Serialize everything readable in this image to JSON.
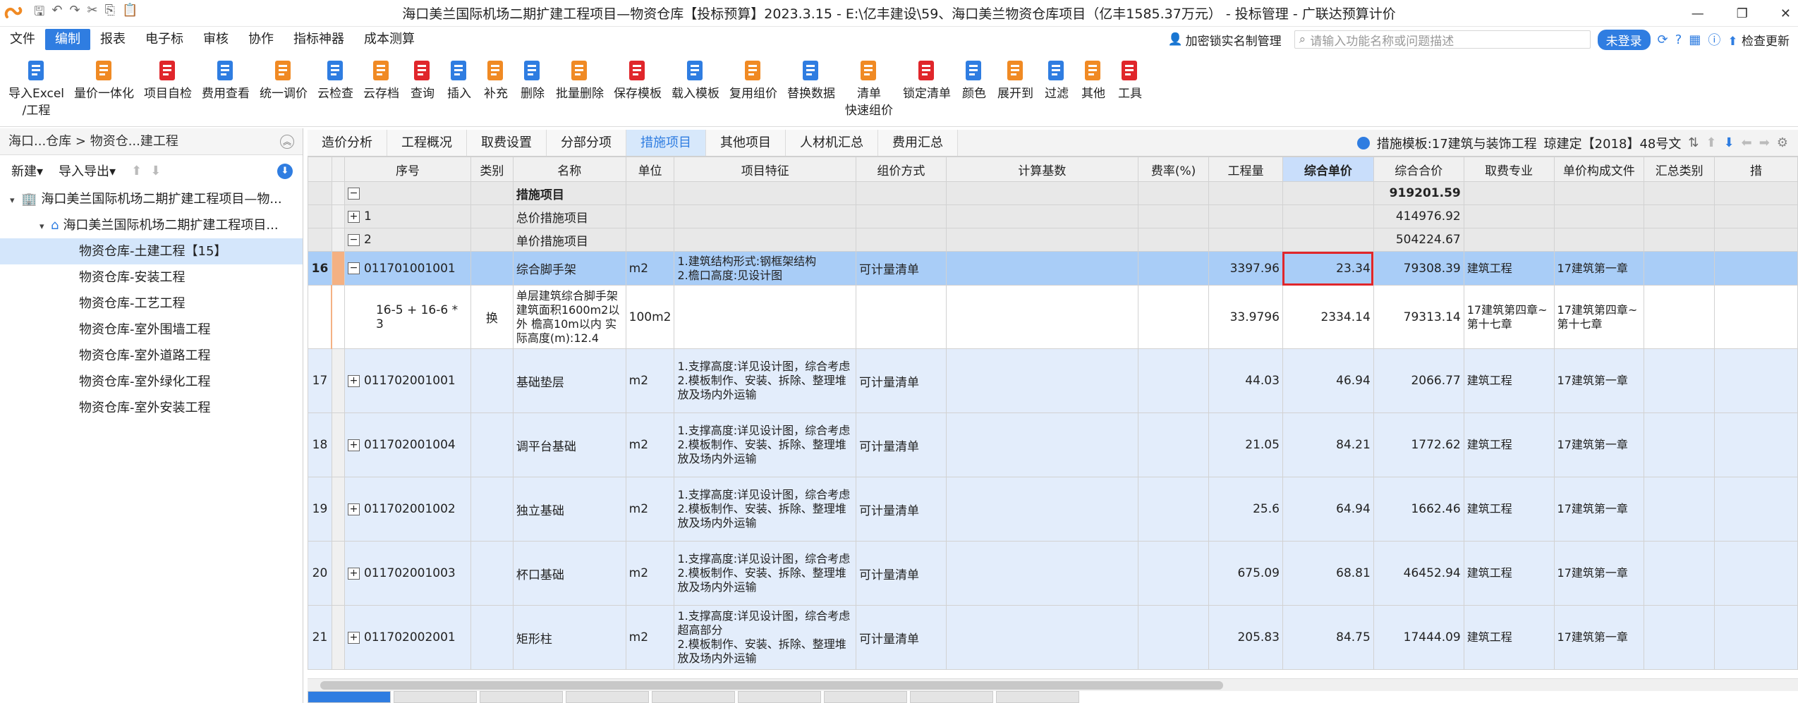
{
  "window": {
    "title": "海口美兰国际机场二期扩建工程项目—物资仓库【投标预算】2023.3.15  - E:\\亿丰建设\\59、海口美兰物资仓库项目（亿丰1585.37万元） - 投标管理 - 广联达预算计价"
  },
  "menu": {
    "items": [
      "文件",
      "编制",
      "报表",
      "电子标",
      "审核",
      "协作",
      "指标神器",
      "成本测算"
    ],
    "encrypt_label": "加密锁实名制管理",
    "search_placeholder": "请输入功能名称或问题描述",
    "login_label": "未登录",
    "update_label": "检查更新"
  },
  "ribbon": [
    {
      "label": "导入Excel",
      "label2": "/工程",
      "icon": "import-excel-icon"
    },
    {
      "label": "量价一体化",
      "icon": "quantity-price-icon"
    },
    {
      "label": "项目自检",
      "icon": "self-check-icon"
    },
    {
      "label": "费用查看",
      "icon": "cost-view-icon"
    },
    {
      "label": "统一调价",
      "icon": "unified-price-icon"
    },
    {
      "label": "云检查",
      "icon": "cloud-check-icon"
    },
    {
      "label": "云存档",
      "icon": "cloud-save-icon"
    },
    {
      "label": "查询",
      "icon": "query-icon"
    },
    {
      "label": "插入",
      "icon": "insert-icon"
    },
    {
      "label": "补充",
      "icon": "supplement-icon"
    },
    {
      "label": "删除",
      "icon": "delete-icon"
    },
    {
      "label": "批量删除",
      "icon": "batch-delete-icon"
    },
    {
      "label": "保存模板",
      "icon": "save-template-icon"
    },
    {
      "label": "载入模板",
      "icon": "load-template-icon"
    },
    {
      "label": "复用组价",
      "icon": "reuse-price-icon"
    },
    {
      "label": "替换数据",
      "icon": "replace-data-icon"
    },
    {
      "label": "清单",
      "label2": "快速组价",
      "icon": "quick-price-icon"
    },
    {
      "label": "锁定清单",
      "icon": "lock-list-icon"
    },
    {
      "label": "颜色",
      "icon": "color-icon"
    },
    {
      "label": "展开到",
      "icon": "expand-to-icon"
    },
    {
      "label": "过滤",
      "icon": "filter-icon"
    },
    {
      "label": "其他",
      "icon": "other-icon"
    },
    {
      "label": "工具",
      "icon": "tools-icon"
    }
  ],
  "left": {
    "breadcrumb": "海口...仓库 > 物资仓...建工程",
    "new_label": "新建",
    "import_export_label": "导入导出",
    "tree": [
      {
        "label": "海口美兰国际机场二期扩建工程项目—物...",
        "level": 0,
        "icon": "building-icon"
      },
      {
        "label": "海口美兰国际机场二期扩建工程项目...",
        "level": 1,
        "icon": "home-icon"
      },
      {
        "label": "物资仓库-土建工程【15】",
        "level": 2,
        "selected": true
      },
      {
        "label": "物资仓库-安装工程",
        "level": 2
      },
      {
        "label": "物资仓库-工艺工程",
        "level": 2
      },
      {
        "label": "物资仓库-室外围墙工程",
        "level": 2
      },
      {
        "label": "物资仓库-室外道路工程",
        "level": 2
      },
      {
        "label": "物资仓库-室外绿化工程",
        "level": 2
      },
      {
        "label": "物资仓库-室外安装工程",
        "level": 2
      }
    ]
  },
  "tabs": {
    "items": [
      "造价分析",
      "工程概况",
      "取费设置",
      "分部分项",
      "措施项目",
      "其他项目",
      "人材机汇总",
      "费用汇总"
    ],
    "active": 4,
    "template_info": "措施模板:17建筑与装饰工程",
    "standard_info": "琼建定【2018】48号文"
  },
  "grid": {
    "headers": [
      "序号",
      "类别",
      "名称",
      "单位",
      "项目特征",
      "组价方式",
      "计算基数",
      "费率(%)",
      "工程量",
      "综合单价",
      "综合合价",
      "取费专业",
      "单价构成文件",
      "汇总类别",
      "措"
    ],
    "rows": [
      {
        "kind": "sec",
        "no": "",
        "code": "",
        "exp": "−",
        "name": "措施项目",
        "total": "919201.59",
        "bold": true
      },
      {
        "kind": "sec",
        "no": "",
        "code": "1",
        "exp": "+",
        "name": "总价措施项目",
        "total": "414976.92"
      },
      {
        "kind": "sec",
        "no": "",
        "code": "2",
        "exp": "−",
        "name": "单价措施项目",
        "total": "504224.67"
      },
      {
        "kind": "sel",
        "no": "16",
        "code": "011701001001",
        "exp": "−",
        "type": "",
        "name": "综合脚手架",
        "unit": "m2",
        "feature": "1.建筑结构形式:钢框架结构\n2.檐口高度:见设计图",
        "method": "可计量清单",
        "qty": "3397.96",
        "price": "23.34",
        "total": "79308.39",
        "major": "建筑工程",
        "file": "17建筑第一章"
      },
      {
        "kind": "sub",
        "no": "",
        "code": "16-5 + 16-6 * 3",
        "exp": "",
        "type": "换",
        "name": "单层建筑综合脚手架 建筑面积1600m2以外 檐高10m以内  实际高度(m):12.4",
        "unit": "100m2",
        "feature": "",
        "method": "",
        "qty": "33.9796",
        "price": "2334.14",
        "total": "79313.14",
        "major": "17建筑第四章~第十七章",
        "file": "17建筑第四章~第十七章"
      },
      {
        "kind": "data",
        "no": "17",
        "code": "011702001001",
        "exp": "+",
        "type": "",
        "name": "基础垫层",
        "unit": "m2",
        "feature": "1.支撑高度:详见设计图，综合考虑\n2.模板制作、安装、拆除、整理堆放及场内外运输",
        "method": "可计量清单",
        "qty": "44.03",
        "price": "46.94",
        "total": "2066.77",
        "major": "建筑工程",
        "file": "17建筑第一章"
      },
      {
        "kind": "data",
        "no": "18",
        "code": "011702001004",
        "exp": "+",
        "type": "",
        "name": "调平台基础",
        "unit": "m2",
        "feature": "1.支撑高度:详见设计图，综合考虑\n2.模板制作、安装、拆除、整理堆放及场内外运输",
        "method": "可计量清单",
        "qty": "21.05",
        "price": "84.21",
        "total": "1772.62",
        "major": "建筑工程",
        "file": "17建筑第一章"
      },
      {
        "kind": "data",
        "no": "19",
        "code": "011702001002",
        "exp": "+",
        "type": "",
        "name": "独立基础",
        "unit": "m2",
        "feature": "1.支撑高度:详见设计图，综合考虑\n2.模板制作、安装、拆除、整理堆放及场内外运输",
        "method": "可计量清单",
        "qty": "25.6",
        "price": "64.94",
        "total": "1662.46",
        "major": "建筑工程",
        "file": "17建筑第一章"
      },
      {
        "kind": "data",
        "no": "20",
        "code": "011702001003",
        "exp": "+",
        "type": "",
        "name": "杯口基础",
        "unit": "m2",
        "feature": "1.支撑高度:详见设计图，综合考虑\n2.模板制作、安装、拆除、整理堆放及场内外运输",
        "method": "可计量清单",
        "qty": "675.09",
        "price": "68.81",
        "total": "46452.94",
        "major": "建筑工程",
        "file": "17建筑第一章"
      },
      {
        "kind": "data",
        "no": "21",
        "code": "011702002001",
        "exp": "+",
        "type": "",
        "name": "矩形柱",
        "unit": "m2",
        "feature": "1.支撑高度:详见设计图，综合考虑超高部分\n2.模板制作、安装、拆除、整理堆放及场内外运输",
        "method": "可计量清单",
        "qty": "205.83",
        "price": "84.75",
        "total": "17444.09",
        "major": "建筑工程",
        "file": "17建筑第一章"
      }
    ]
  }
}
